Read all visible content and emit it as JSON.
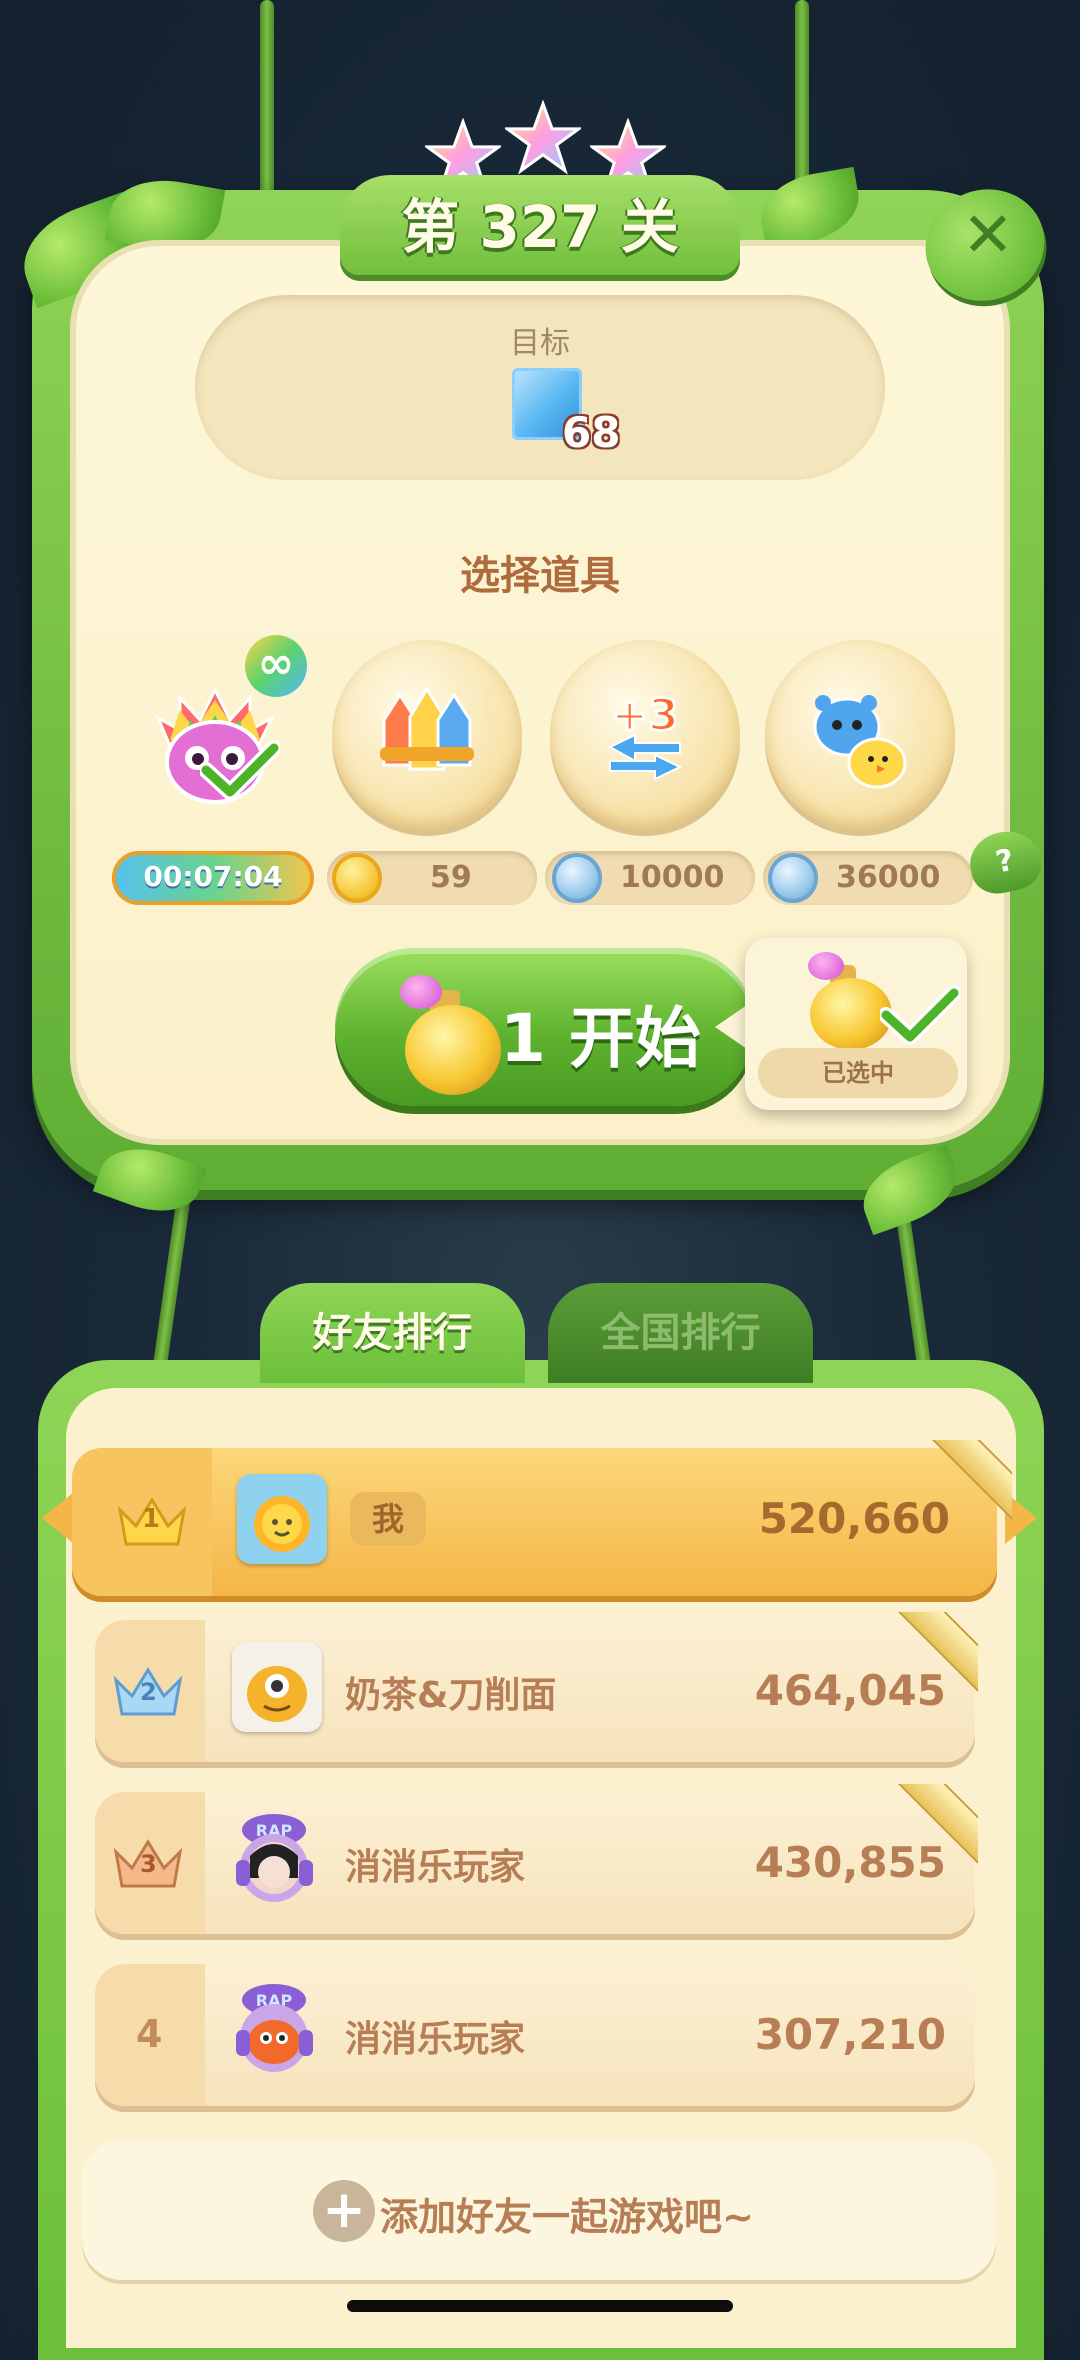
{
  "level": {
    "title": "第 327 关",
    "stars": 3
  },
  "goal": {
    "label": "目标",
    "item_icon": "blue-ice-block",
    "count": "68"
  },
  "props": {
    "section_title": "选择道具",
    "timed_item": {
      "icon": "rainbow-owl-icon",
      "badge_icon": "infinity-icon",
      "timer": "00:07:04"
    },
    "items": [
      {
        "icon": "rockets-icon",
        "currency": "gold-coin",
        "price": "59"
      },
      {
        "icon": "plus-three-moves-icon",
        "currency": "silver-coin",
        "price": "10000"
      },
      {
        "icon": "swap-animals-icon",
        "currency": "silver-coin",
        "price": "36000"
      }
    ],
    "help_label": "?"
  },
  "start": {
    "label": "1 开始",
    "selected_label": "已选中"
  },
  "tabs": [
    {
      "label": "好友排行",
      "active": true
    },
    {
      "label": "全国排行",
      "active": false
    }
  ],
  "leaderboard": [
    {
      "rank": "1",
      "name": "我",
      "score": "520,660",
      "is_me": true
    },
    {
      "rank": "2",
      "name": "奶茶&刀削面",
      "score": "464,045"
    },
    {
      "rank": "3",
      "name": "消消乐玩家",
      "score": "430,855"
    },
    {
      "rank": "4",
      "name": "消消乐玩家",
      "score": "307,210"
    }
  ],
  "add_friend": {
    "label": "添加好友一起游戏吧~"
  },
  "colors": {
    "panel_green": "#6cbf3a",
    "cream": "#fbf0c9",
    "text_brown": "#b77d55",
    "gold": "#f4b647"
  }
}
